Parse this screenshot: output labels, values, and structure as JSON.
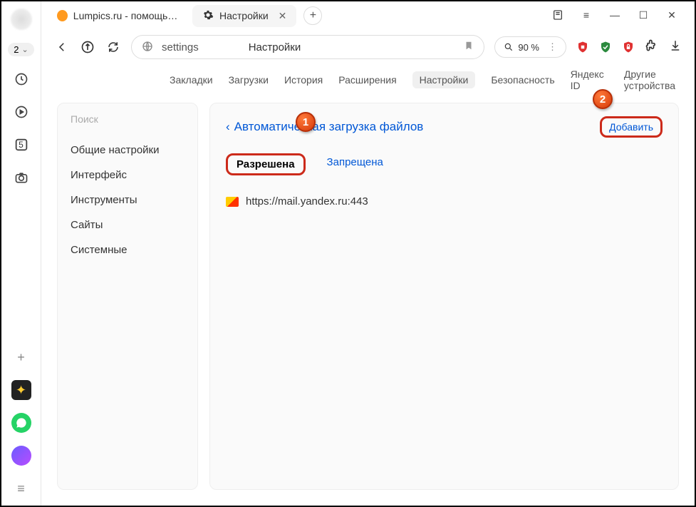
{
  "left_rail": {
    "tab_count": "2",
    "screenshot_badge": "5"
  },
  "tabs": {
    "tab1_title": "Lumpics.ru - помощь с ко",
    "tab2_title": "Настройки"
  },
  "address": {
    "url_text": "settings",
    "page_title": "Настройки",
    "zoom": "90 %"
  },
  "nav": {
    "bookmarks": "Закладки",
    "downloads": "Загрузки",
    "history": "История",
    "extensions": "Расширения",
    "settings": "Настройки",
    "security": "Безопасность",
    "yandex_id": "Яндекс ID",
    "other_devices": "Другие устройства"
  },
  "sidebar": {
    "search_placeholder": "Поиск",
    "items": [
      "Общие настройки",
      "Интерфейс",
      "Инструменты",
      "Сайты",
      "Системные"
    ]
  },
  "panel": {
    "title": "Автоматическая загрузка файлов",
    "add_label": "Добавить",
    "tab_allowed": "Разрешена",
    "tab_denied": "Запрещена",
    "sites": [
      "https://mail.yandex.ru:443"
    ]
  },
  "callouts": {
    "one": "1",
    "two": "2"
  }
}
